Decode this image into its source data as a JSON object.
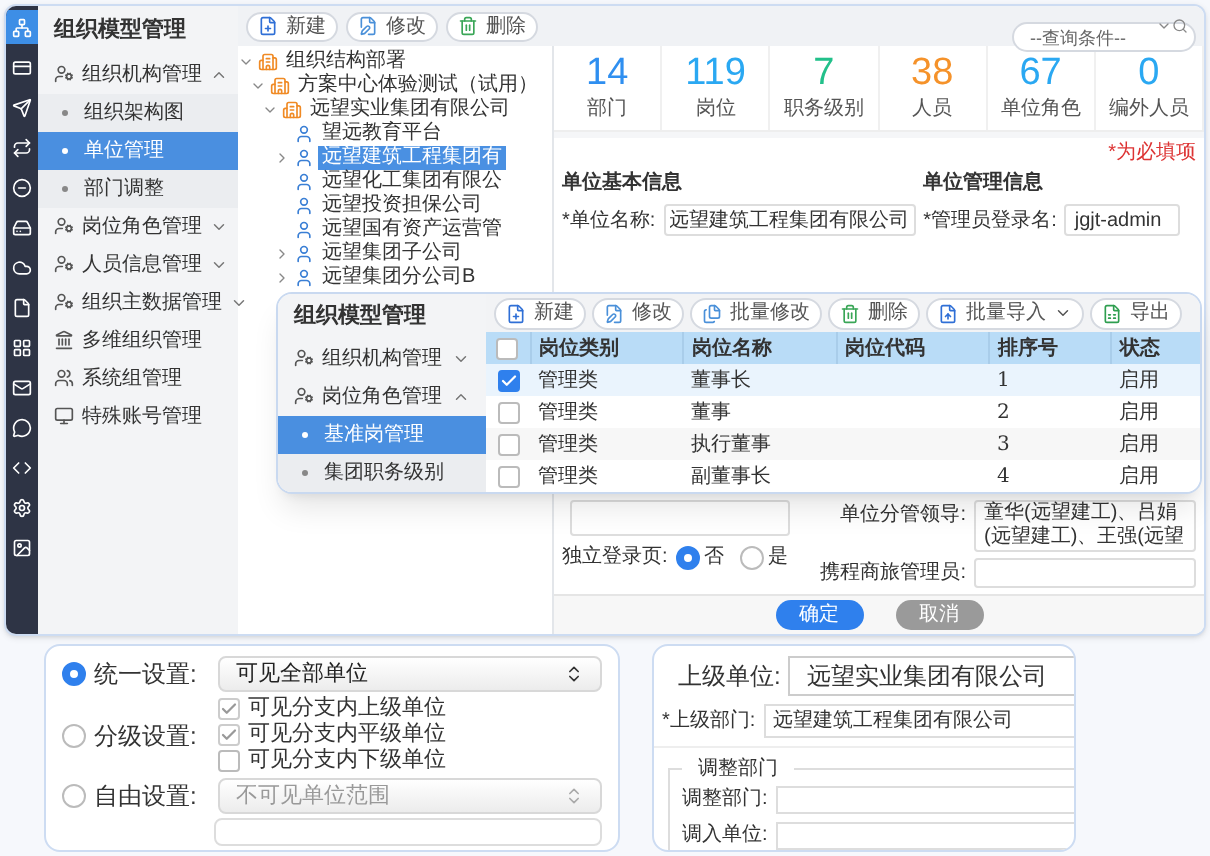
{
  "main_window": {
    "rail": [
      {
        "selected": true
      },
      {
        "selected": false
      },
      {
        "selected": false
      },
      {
        "selected": false
      },
      {
        "selected": false
      },
      {
        "selected": false
      },
      {
        "selected": false
      },
      {
        "selected": false
      },
      {
        "selected": false
      },
      {
        "selected": false
      },
      {
        "selected": false
      },
      {
        "selected": false
      },
      {
        "selected": false
      },
      {
        "selected": false
      }
    ],
    "sidebar": {
      "title": "组织模型管理",
      "items": [
        {
          "label": "组织机构管理",
          "kind": "group",
          "expanded": true,
          "children": [
            {
              "label": "组织架构图",
              "selected": false
            },
            {
              "label": "单位管理",
              "selected": true
            },
            {
              "label": "部门调整",
              "selected": false
            }
          ]
        },
        {
          "label": "岗位角色管理",
          "kind": "group",
          "expanded": false
        },
        {
          "label": "人员信息管理",
          "kind": "group",
          "expanded": false
        },
        {
          "label": "组织主数据管理",
          "kind": "group",
          "expanded": false
        },
        {
          "label": "多维组织管理",
          "kind": "bank"
        },
        {
          "label": "系统组管理",
          "kind": "people"
        },
        {
          "label": "特殊账号管理",
          "kind": "monitor"
        }
      ]
    },
    "toolbar": {
      "buttons": [
        {
          "label": "新建",
          "kind": "new"
        },
        {
          "label": "修改",
          "kind": "edit"
        },
        {
          "label": "删除",
          "kind": "delete"
        }
      ],
      "query": {
        "placeholder": "--查询条件--"
      }
    },
    "tree": [
      {
        "label": "组织结构部署",
        "kind": "org",
        "expanded": true,
        "selected": false,
        "children": [
          {
            "label": "方案中心体验测试（试用）",
            "kind": "org",
            "expanded": true,
            "selected": false,
            "children": [
              {
                "label": "远望实业集团有限公司",
                "kind": "org",
                "expanded": true,
                "selected": false,
                "children": [
                  {
                    "label": "望远教育平台",
                    "kind": "unit",
                    "selected": false
                  },
                  {
                    "label": "远望建筑工程集团有",
                    "kind": "unit",
                    "expanded": false,
                    "selected": true
                  },
                  {
                    "label": "远望化工集团有限公",
                    "kind": "unit",
                    "selected": false
                  },
                  {
                    "label": "远望投资担保公司",
                    "kind": "unit",
                    "selected": false
                  },
                  {
                    "label": "远望国有资产运营管",
                    "kind": "unit",
                    "selected": false
                  },
                  {
                    "label": "远望集团子公司",
                    "kind": "unit",
                    "expanded": false,
                    "selected": false
                  },
                  {
                    "label": "远望集团分公司B",
                    "kind": "unit",
                    "expanded": false,
                    "selected": false
                  }
                ]
              }
            ]
          }
        ]
      }
    ],
    "stats": [
      {
        "value": "14",
        "label": "部门",
        "color": "#2f8ff0"
      },
      {
        "value": "119",
        "label": "岗位",
        "color": "#2aa8f2"
      },
      {
        "value": "7",
        "label": "职务级别",
        "color": "#22c08a"
      },
      {
        "value": "38",
        "label": "人员",
        "color": "#f5922a"
      },
      {
        "value": "67",
        "label": "单位角色",
        "color": "#2aa8f2"
      },
      {
        "value": "0",
        "label": "编外人员",
        "color": "#2aa8f2"
      }
    ],
    "form": {
      "required_note": "*为必填项",
      "basic_heading": "单位基本信息",
      "admin_heading": "单位管理信息",
      "unit_name": {
        "label": "*单位名称:",
        "value": "远望建筑工程集团有限公司"
      },
      "admin_login": {
        "label": "*管理员登录名:",
        "value": "jgjt-admin"
      },
      "leaders": {
        "label": "单位分管领导:",
        "value": "童华(远望建工)、吕娟(远望建工)、王强(远望"
      },
      "independent_login": {
        "label": "独立登录页:",
        "options": [
          {
            "label": "否",
            "selected": true
          },
          {
            "label": "是",
            "selected": false
          }
        ]
      },
      "travel_admin": {
        "label": "携程商旅管理员:"
      }
    },
    "buttons": [
      {
        "label": "确定",
        "kind": "primary"
      },
      {
        "label": "取消",
        "kind": "secondary"
      }
    ]
  },
  "overlay_window": {
    "title": "组织模型管理",
    "nav": [
      {
        "label": "组织机构管理",
        "expanded": false
      },
      {
        "label": "岗位角色管理",
        "expanded": true,
        "children": [
          {
            "label": "基准岗管理",
            "selected": true
          },
          {
            "label": "集团职务级别",
            "selected": false
          }
        ]
      }
    ],
    "toolbar": [
      {
        "label": "新建",
        "kind": "new"
      },
      {
        "label": "修改",
        "kind": "edit"
      },
      {
        "label": "批量修改",
        "kind": "batchedit"
      },
      {
        "label": "删除",
        "kind": "delete"
      },
      {
        "label": "批量导入",
        "kind": "import"
      },
      {
        "label": "导出",
        "kind": "export"
      }
    ],
    "table": {
      "columns": [
        "岗位类别",
        "岗位名称",
        "岗位代码",
        "排序号",
        "状态"
      ],
      "all_checked": false,
      "rows": [
        {
          "category": "管理类",
          "name": "董事长",
          "order": "1",
          "status": "启用",
          "checked": true,
          "selected": true
        },
        {
          "category": "管理类",
          "name": "董事",
          "order": "2",
          "status": "启用",
          "checked": false,
          "selected": false
        },
        {
          "category": "管理类",
          "name": "执行董事",
          "order": "3",
          "status": "启用",
          "checked": false,
          "selected": false
        },
        {
          "category": "管理类",
          "name": "副董事长",
          "order": "4",
          "status": "启用",
          "checked": false,
          "selected": false
        }
      ]
    }
  },
  "visibility_card": {
    "options": [
      {
        "label": "统一设置:",
        "selected": true,
        "kind": "select",
        "value": "可见全部单位"
      },
      {
        "label": "分级设置:",
        "selected": false,
        "kind": "checks",
        "checks": [
          {
            "label": "可见分支内上级单位",
            "checked": true
          },
          {
            "label": "可见分支内平级单位",
            "checked": true
          },
          {
            "label": "可见分支内下级单位",
            "checked": false
          }
        ]
      },
      {
        "label": "自由设置:",
        "selected": false,
        "kind": "select",
        "placeholder": "不可见单位范围",
        "disabled": true
      }
    ]
  },
  "parent_card": {
    "parent_unit": {
      "label": "上级单位:",
      "value": "远望实业集团有限公司"
    },
    "parent_dept": {
      "label": "*上级部门:",
      "value": "远望建筑工程集团有限公司"
    },
    "adjust": {
      "legend": "调整部门",
      "fields": [
        {
          "label": "调整部门:"
        },
        {
          "label": "调入单位:"
        }
      ]
    }
  }
}
